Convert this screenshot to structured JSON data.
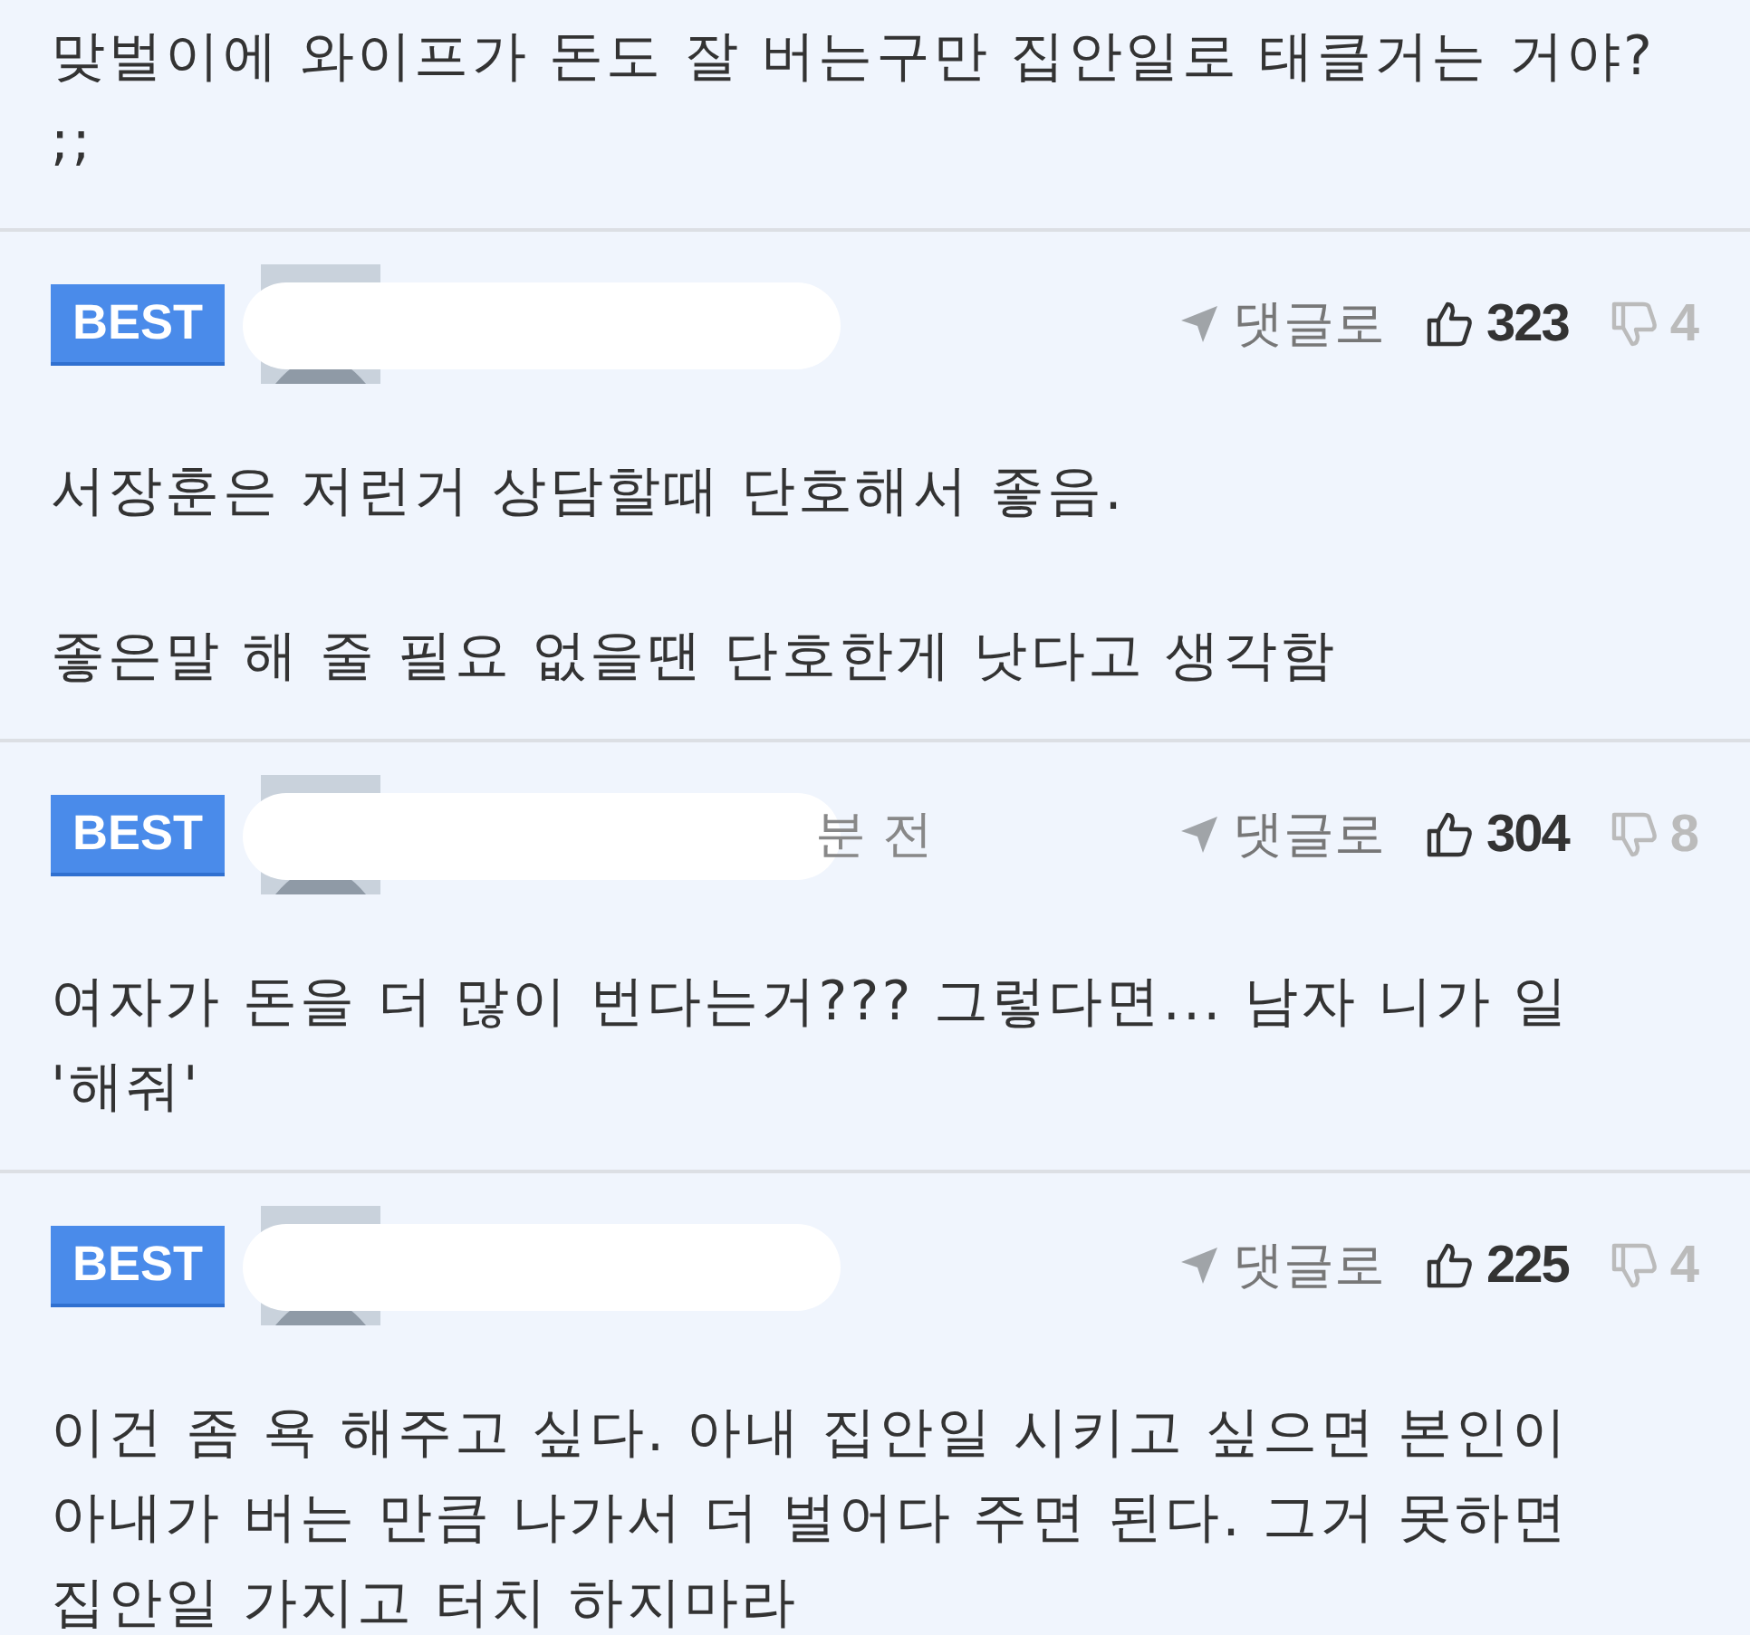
{
  "top_comment": {
    "text": "맞벌이에 와이프가 돈도 잘 버는구만 집안일로 태클거는 거야? ;;"
  },
  "comments": [
    {
      "badge": "BEST",
      "redacted": true,
      "reply_label": "댓글로",
      "likes": "323",
      "dislikes": "4",
      "paragraphs": [
        "서장훈은 저런거 상담할때 단호해서 좋음.",
        "좋은말 해 줄 필요 없을땐 단호한게 낫다고 생각함"
      ]
    },
    {
      "badge": "BEST",
      "redacted": true,
      "time": "분 전",
      "reply_label": "댓글로",
      "likes": "304",
      "dislikes": "8",
      "paragraphs": [
        "여자가 돈을 더 많이 번다는거??? 그렇다면... 남자 니가 일 '해줘'"
      ]
    },
    {
      "badge": "BEST",
      "redacted": true,
      "reply_label": "댓글로",
      "likes": "225",
      "dislikes": "4",
      "paragraphs": [
        "이건 좀 욕 해주고 싶다. 아내 집안일 시키고 싶으면 본인이 아내가 버는 만큼 나가서 더 벌어다 주면 된다. 그거 못하면 집안일 가지고 터치 하지마라"
      ]
    }
  ]
}
